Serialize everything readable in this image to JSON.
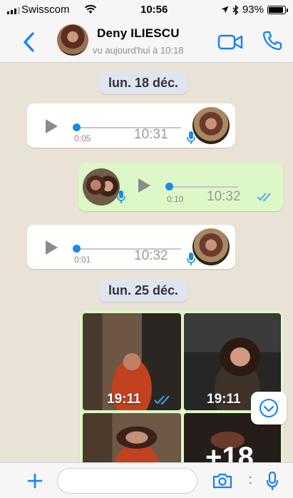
{
  "status_bar": {
    "carrier": "Swisscom",
    "time": "10:56",
    "battery": "93%",
    "battery_level": 0.93
  },
  "header": {
    "contact_name": "Deny ILIESCU",
    "contact_status": "vu aujourd'hui à 10:18"
  },
  "chat": {
    "date_separators": [
      "lun. 18 déc.",
      "lun. 25 déc."
    ],
    "voice_messages": [
      {
        "direction": "incoming",
        "duration": "0:05",
        "time": "10:31"
      },
      {
        "direction": "outgoing",
        "duration": "0:10",
        "time": "10:32",
        "status": "read"
      },
      {
        "direction": "incoming",
        "duration": "0:01",
        "time": "10:32"
      }
    ],
    "media_group": {
      "direction": "outgoing",
      "photos": [
        {
          "time": "19:11",
          "status": "read"
        },
        {
          "time": "19:11"
        }
      ],
      "more_count": "+18"
    }
  },
  "input_bar": {
    "placeholder": ""
  },
  "colors": {
    "accent": "#1b8ae6",
    "outgoing_bubble": "#dcf8c6",
    "incoming_bubble": "#ffffff",
    "date_pill": "#dde5f0",
    "chat_background": "#e9e2d6"
  },
  "icons": {
    "back": "chevron-left-icon",
    "video_call": "video-camera-icon",
    "voice_call": "phone-icon",
    "play": "play-icon",
    "mic": "microphone-icon",
    "read": "double-check-icon",
    "scroll_down": "chevron-down-circle-icon",
    "attach": "plus-icon",
    "camera": "camera-icon"
  }
}
